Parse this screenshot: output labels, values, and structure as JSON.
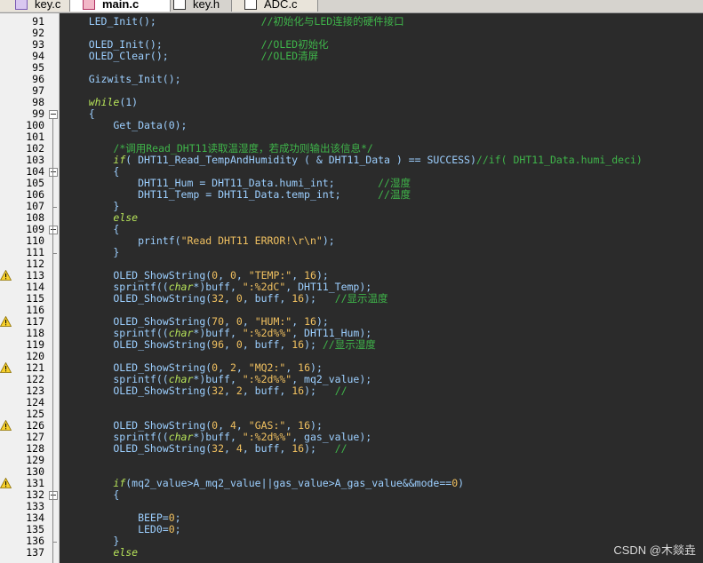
{
  "tabs": [
    {
      "label": "key.c",
      "type": "c",
      "active": false
    },
    {
      "label": "main.c",
      "type": "c",
      "active": true
    },
    {
      "label": "key.h",
      "type": "h",
      "active": false
    },
    {
      "label": "ADC.c",
      "type": "adc",
      "active": false
    }
  ],
  "lines": [
    {
      "n": "91",
      "t": [
        [
          "    LED_Init();                 ",
          ""
        ],
        [
          "//初始化与LED连接的硬件接口",
          "cm"
        ]
      ]
    },
    {
      "n": "92",
      "t": []
    },
    {
      "n": "93",
      "t": [
        [
          "    OLED_Init();                ",
          ""
        ],
        [
          "//OLED初始化",
          "cm"
        ]
      ]
    },
    {
      "n": "94",
      "t": [
        [
          "    OLED_Clear();               ",
          ""
        ],
        [
          "//OLED清屏",
          "cm"
        ]
      ]
    },
    {
      "n": "95",
      "t": []
    },
    {
      "n": "96",
      "t": [
        [
          "    Gizwits_Init();",
          ""
        ]
      ]
    },
    {
      "n": "97",
      "t": []
    },
    {
      "n": "98",
      "t": [
        [
          "    ",
          ""
        ],
        [
          "while",
          "kw"
        ],
        [
          "(1)",
          ""
        ]
      ]
    },
    {
      "n": "99",
      "t": [
        [
          "    {",
          ""
        ]
      ]
    },
    {
      "n": "100",
      "t": [
        [
          "        Get_Data(0);",
          ""
        ]
      ]
    },
    {
      "n": "101",
      "t": []
    },
    {
      "n": "102",
      "t": [
        [
          "        ",
          ""
        ],
        [
          "/*调用Read_DHT11读取温湿度，若成功则输出该信息*/",
          "cm"
        ]
      ]
    },
    {
      "n": "103",
      "t": [
        [
          "        ",
          ""
        ],
        [
          "if",
          "kw"
        ],
        [
          "( DHT11_Read_TempAndHumidity ( & DHT11_Data ) == SUCCESS)",
          ""
        ],
        [
          "//if( DHT11_Data.humi_deci)",
          "cm"
        ]
      ]
    },
    {
      "n": "104",
      "t": [
        [
          "        {",
          ""
        ]
      ]
    },
    {
      "n": "105",
      "t": [
        [
          "            DHT11_Hum = DHT11_Data.humi_int;       ",
          ""
        ],
        [
          "//湿度",
          "cm"
        ]
      ]
    },
    {
      "n": "106",
      "t": [
        [
          "            DHT11_Temp = DHT11_Data.temp_int;      ",
          ""
        ],
        [
          "//温度",
          "cm"
        ]
      ]
    },
    {
      "n": "107",
      "t": [
        [
          "        }",
          ""
        ]
      ]
    },
    {
      "n": "108",
      "t": [
        [
          "        ",
          ""
        ],
        [
          "else",
          "kw"
        ]
      ]
    },
    {
      "n": "109",
      "t": [
        [
          "        {",
          ""
        ]
      ]
    },
    {
      "n": "110",
      "t": [
        [
          "            printf(",
          ""
        ],
        [
          "\"Read DHT11 ERROR!\\r\\n\"",
          "str"
        ],
        [
          ");",
          ""
        ]
      ]
    },
    {
      "n": "111",
      "t": [
        [
          "        }",
          ""
        ]
      ]
    },
    {
      "n": "112",
      "t": []
    },
    {
      "n": "113",
      "t": [
        [
          "        OLED_ShowString(",
          ""
        ],
        [
          "0",
          "num"
        ],
        [
          ", ",
          ""
        ],
        [
          "0",
          "num"
        ],
        [
          ", ",
          ""
        ],
        [
          "\"TEMP:\"",
          "str"
        ],
        [
          ", ",
          ""
        ],
        [
          "16",
          "num"
        ],
        [
          ");",
          ""
        ]
      ]
    },
    {
      "n": "114",
      "t": [
        [
          "        sprintf((",
          ""
        ],
        [
          "char",
          "kw"
        ],
        [
          "*)buff, ",
          ""
        ],
        [
          "\":%2dC\"",
          "str"
        ],
        [
          ", DHT11_Temp);",
          ""
        ]
      ]
    },
    {
      "n": "115",
      "t": [
        [
          "        OLED_ShowString(",
          ""
        ],
        [
          "32",
          "num"
        ],
        [
          ", ",
          ""
        ],
        [
          "0",
          "num"
        ],
        [
          ", buff, ",
          ""
        ],
        [
          "16",
          "num"
        ],
        [
          ");   ",
          ""
        ],
        [
          "//显示温度",
          "cm"
        ]
      ]
    },
    {
      "n": "116",
      "t": []
    },
    {
      "n": "117",
      "t": [
        [
          "        OLED_ShowString(",
          ""
        ],
        [
          "70",
          "num"
        ],
        [
          ", ",
          ""
        ],
        [
          "0",
          "num"
        ],
        [
          ", ",
          ""
        ],
        [
          "\"HUM:\"",
          "str"
        ],
        [
          ", ",
          ""
        ],
        [
          "16",
          "num"
        ],
        [
          ");",
          ""
        ]
      ]
    },
    {
      "n": "118",
      "t": [
        [
          "        sprintf((",
          ""
        ],
        [
          "char",
          "kw"
        ],
        [
          "*)buff, ",
          ""
        ],
        [
          "\":%2d%%\"",
          "str"
        ],
        [
          ", DHT11_Hum);",
          ""
        ]
      ]
    },
    {
      "n": "119",
      "t": [
        [
          "        OLED_ShowString(",
          ""
        ],
        [
          "96",
          "num"
        ],
        [
          ", ",
          ""
        ],
        [
          "0",
          "num"
        ],
        [
          ", buff, ",
          ""
        ],
        [
          "16",
          "num"
        ],
        [
          "); ",
          ""
        ],
        [
          "//显示湿度",
          "cm"
        ]
      ]
    },
    {
      "n": "120",
      "t": []
    },
    {
      "n": "121",
      "t": [
        [
          "        OLED_ShowString(",
          ""
        ],
        [
          "0",
          "num"
        ],
        [
          ", ",
          ""
        ],
        [
          "2",
          "num"
        ],
        [
          ", ",
          ""
        ],
        [
          "\"MQ2:\"",
          "str"
        ],
        [
          ", ",
          ""
        ],
        [
          "16",
          "num"
        ],
        [
          ");",
          ""
        ]
      ]
    },
    {
      "n": "122",
      "t": [
        [
          "        sprintf((",
          ""
        ],
        [
          "char",
          "kw"
        ],
        [
          "*)buff, ",
          ""
        ],
        [
          "\":%2d%%\"",
          "str"
        ],
        [
          ", mq2_value);",
          ""
        ]
      ]
    },
    {
      "n": "123",
      "t": [
        [
          "        OLED_ShowString(",
          ""
        ],
        [
          "32",
          "num"
        ],
        [
          ", ",
          ""
        ],
        [
          "2",
          "num"
        ],
        [
          ", buff, ",
          ""
        ],
        [
          "16",
          "num"
        ],
        [
          ");   ",
          ""
        ],
        [
          "//",
          "cm"
        ]
      ]
    },
    {
      "n": "124",
      "t": []
    },
    {
      "n": "125",
      "t": []
    },
    {
      "n": "126",
      "t": [
        [
          "        OLED_ShowString(",
          ""
        ],
        [
          "0",
          "num"
        ],
        [
          ", ",
          ""
        ],
        [
          "4",
          "num"
        ],
        [
          ", ",
          ""
        ],
        [
          "\"GAS:\"",
          "str"
        ],
        [
          ", ",
          ""
        ],
        [
          "16",
          "num"
        ],
        [
          ");",
          ""
        ]
      ]
    },
    {
      "n": "127",
      "t": [
        [
          "        sprintf((",
          ""
        ],
        [
          "char",
          "kw"
        ],
        [
          "*)buff, ",
          ""
        ],
        [
          "\":%2d%%\"",
          "str"
        ],
        [
          ", gas_value);",
          ""
        ]
      ]
    },
    {
      "n": "128",
      "t": [
        [
          "        OLED_ShowString(",
          ""
        ],
        [
          "32",
          "num"
        ],
        [
          ", ",
          ""
        ],
        [
          "4",
          "num"
        ],
        [
          ", buff, ",
          ""
        ],
        [
          "16",
          "num"
        ],
        [
          ");   ",
          ""
        ],
        [
          "//",
          "cm"
        ]
      ]
    },
    {
      "n": "129",
      "t": []
    },
    {
      "n": "130",
      "t": []
    },
    {
      "n": "131",
      "t": [
        [
          "        ",
          ""
        ],
        [
          "if",
          "kw"
        ],
        [
          "(mq2_value>A_mq2_value||gas_value>A_gas_value&&mode==",
          ""
        ],
        [
          "0",
          "num"
        ],
        [
          ")",
          ""
        ]
      ]
    },
    {
      "n": "132",
      "t": [
        [
          "        {",
          ""
        ]
      ]
    },
    {
      "n": "133",
      "t": []
    },
    {
      "n": "134",
      "t": [
        [
          "            BEEP=",
          ""
        ],
        [
          "0",
          "num"
        ],
        [
          ";",
          ""
        ]
      ]
    },
    {
      "n": "135",
      "t": [
        [
          "            LED0=",
          ""
        ],
        [
          "0",
          "num"
        ],
        [
          ";",
          ""
        ]
      ]
    },
    {
      "n": "136",
      "t": [
        [
          "        }",
          ""
        ]
      ]
    },
    {
      "n": "137",
      "t": [
        [
          "        ",
          ""
        ],
        [
          "else",
          "kw"
        ]
      ]
    }
  ],
  "warnings": [
    "113",
    "117",
    "121",
    "126",
    "131"
  ],
  "folds": [
    "99",
    "104",
    "109",
    "132"
  ],
  "watermark": "CSDN @木燚垚"
}
